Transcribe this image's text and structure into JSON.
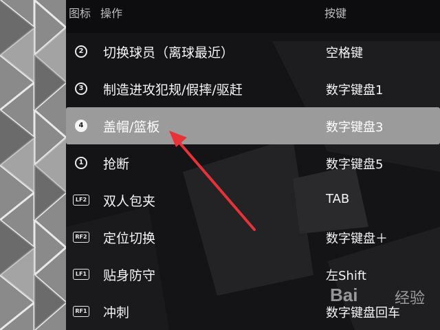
{
  "header": {
    "icon_col": "图标",
    "action_col": "操作",
    "key_col": "按键"
  },
  "rows": [
    {
      "icon": "circle-2",
      "icon_text": "2",
      "label": "切换球员（离球最近）",
      "key": "空格键"
    },
    {
      "icon": "circle-3",
      "icon_text": "3",
      "label": "制造进攻犯规/假摔/驱赶",
      "key": "数字键盘1"
    },
    {
      "icon": "circle-4-filled",
      "icon_text": "4",
      "label": "盖帽/篮板",
      "key": "数字键盘3",
      "selected": true
    },
    {
      "icon": "circle-1",
      "icon_text": "1",
      "label": "抢断",
      "key": "数字键盘5"
    },
    {
      "icon": "lf2-button",
      "icon_text": "LF2",
      "label": "双人包夹",
      "key": "TAB"
    },
    {
      "icon": "rf2-button",
      "icon_text": "RF2",
      "label": "定位切换",
      "key": "数字键盘＋"
    },
    {
      "icon": "lf1-button",
      "icon_text": "LF1",
      "label": "贴身防守",
      "key": "左Shift"
    },
    {
      "icon": "rf1-button",
      "icon_text": "RF1",
      "label": "冲刺",
      "key": "数字键盘回车"
    }
  ],
  "annotation": {
    "arrow_color": "#e8323a"
  },
  "watermark": {
    "brand": "Bai",
    "suffix": "经验"
  }
}
